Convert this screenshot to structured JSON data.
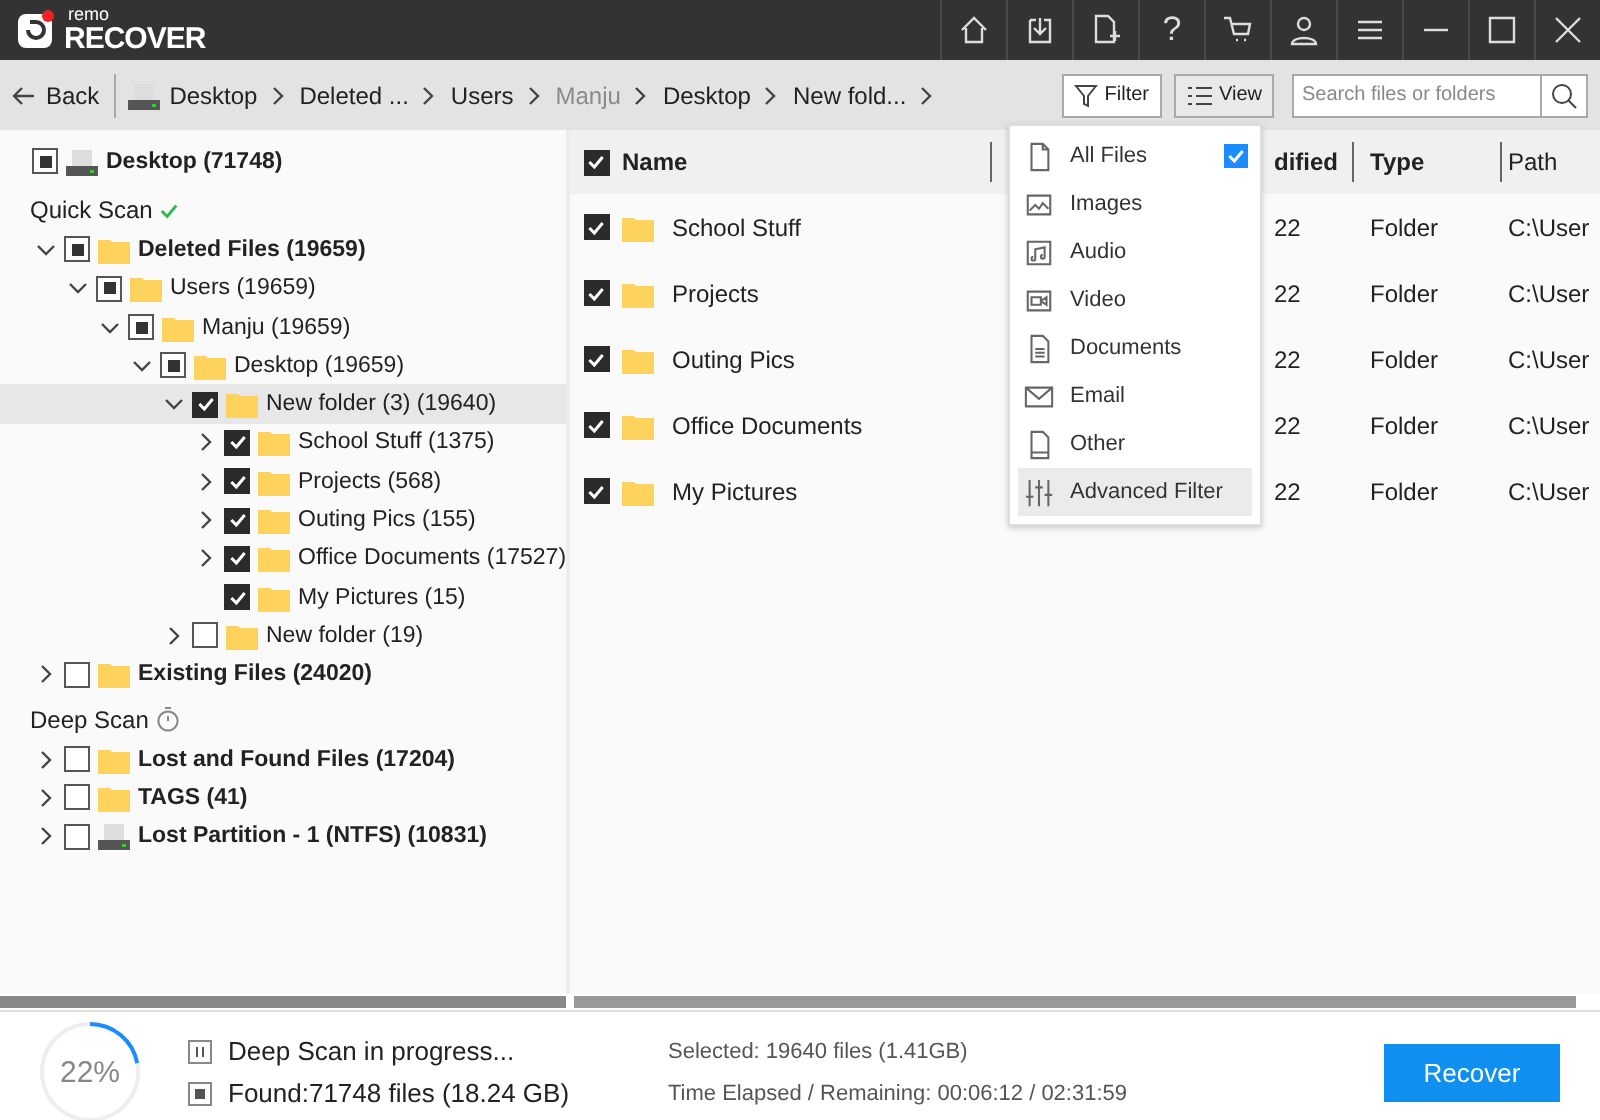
{
  "app": {
    "logo_small": "remo",
    "logo_large": "RECOVER",
    "help": "?"
  },
  "toolbar": {
    "back": "Back",
    "breadcrumb": [
      {
        "label": "Desktop",
        "kind": "drive"
      },
      {
        "label": "Deleted ...",
        "kind": "plain"
      },
      {
        "label": "Users",
        "kind": "plain"
      },
      {
        "label": "Manju",
        "kind": "masked"
      },
      {
        "label": "Desktop",
        "kind": "plain"
      },
      {
        "label": "New fold...",
        "kind": "plain"
      }
    ],
    "filter": "Filter",
    "view": "View",
    "search": {
      "placeholder": "Search files or folders"
    }
  },
  "tree": {
    "drive": {
      "label": "Desktop (71748)",
      "checked": false,
      "partial": true
    },
    "sections": [
      {
        "title": "Quick Scan",
        "kind": "done",
        "items": [
          {
            "label": "Deleted Files (19659)",
            "checked": false,
            "partial": true,
            "expandable": true,
            "expanded": true,
            "kind": "folder",
            "selected": false,
            "children": [
              {
                "label": "Users (19659)",
                "checked": false,
                "partial": true,
                "expandable": true,
                "expanded": true,
                "kind": "folder",
                "selected": false,
                "children": [
                  {
                    "label": "Manju (19659)",
                    "checked": false,
                    "partial": true,
                    "expandable": true,
                    "expanded": true,
                    "kind": "folder",
                    "selected": false,
                    "children": [
                      {
                        "label": "Desktop (19659)",
                        "checked": false,
                        "partial": true,
                        "expandable": true,
                        "expanded": true,
                        "kind": "folder",
                        "selected": false,
                        "children": [
                          {
                            "label": "New folder (3) (19640)",
                            "checked": true,
                            "expandable": true,
                            "expanded": true,
                            "kind": "folder",
                            "selected": true,
                            "children": [
                              {
                                "label": "School Stuff (1375)",
                                "checked": true,
                                "expandable": true,
                                "expanded": false,
                                "kind": "folder",
                                "selected": false
                              },
                              {
                                "label": "Projects (568)",
                                "checked": true,
                                "expandable": true,
                                "expanded": false,
                                "kind": "folder",
                                "selected": false
                              },
                              {
                                "label": "Outing Pics (155)",
                                "checked": true,
                                "expandable": true,
                                "expanded": false,
                                "kind": "folder",
                                "selected": false
                              },
                              {
                                "label": "Office Documents (17527)",
                                "checked": true,
                                "expandable": true,
                                "expanded": false,
                                "kind": "folder",
                                "selected": false
                              },
                              {
                                "label": "My Pictures (15)",
                                "checked": true,
                                "expandable": false,
                                "kind": "folder",
                                "selected": false
                              }
                            ]
                          },
                          {
                            "label": "New folder (19)",
                            "checked": false,
                            "partial": false,
                            "expandable": true,
                            "expanded": false,
                            "kind": "folder",
                            "selected": false
                          }
                        ]
                      }
                    ]
                  }
                ]
              }
            ]
          },
          {
            "label": "Existing Files (24020)",
            "checked": false,
            "partial": false,
            "expandable": true,
            "expanded": false,
            "kind": "folder",
            "selected": false
          }
        ]
      },
      {
        "title": "Deep Scan",
        "kind": "pending",
        "items": [
          {
            "label": "Lost and Found Files (17204)",
            "checked": false,
            "partial": false,
            "expandable": true,
            "expanded": false,
            "kind": "folder",
            "selected": false
          },
          {
            "label": "TAGS (41)",
            "checked": false,
            "partial": false,
            "expandable": true,
            "expanded": false,
            "kind": "folder",
            "selected": false
          },
          {
            "label": "Lost Partition - 1 (NTFS) (10831)",
            "checked": false,
            "partial": false,
            "expandable": true,
            "expanded": false,
            "kind": "partition",
            "selected": false
          }
        ]
      }
    ]
  },
  "table": {
    "all_checked": true,
    "columns": [
      "Name",
      "dified",
      "Type",
      "Path"
    ],
    "rows": [
      {
        "checked": true,
        "name": "School Stuff",
        "modified": "22",
        "type": "Folder",
        "path": "C:\\User"
      },
      {
        "checked": true,
        "name": "Projects",
        "modified": "22",
        "type": "Folder",
        "path": "C:\\User"
      },
      {
        "checked": true,
        "name": "Outing Pics",
        "modified": "22",
        "type": "Folder",
        "path": "C:\\User"
      },
      {
        "checked": true,
        "name": "Office Documents",
        "modified": "22",
        "type": "Folder",
        "path": "C:\\User"
      },
      {
        "checked": true,
        "name": "My Pictures",
        "modified": "22",
        "type": "Folder",
        "path": "C:\\User"
      }
    ]
  },
  "filter_menu": [
    {
      "label": "All Files",
      "kind": "all",
      "checked": true,
      "selected": false
    },
    {
      "label": "Images",
      "kind": "image",
      "checked": false,
      "selected": false
    },
    {
      "label": "Audio",
      "kind": "audio",
      "checked": false,
      "selected": false
    },
    {
      "label": "Video",
      "kind": "video",
      "checked": false,
      "selected": false
    },
    {
      "label": "Documents",
      "kind": "document",
      "checked": false,
      "selected": false
    },
    {
      "label": "Email",
      "kind": "email",
      "checked": false,
      "selected": false
    },
    {
      "label": "Other",
      "kind": "other",
      "checked": false,
      "selected": false
    },
    {
      "label": "Advanced Filter",
      "kind": "advanced",
      "checked": false,
      "selected": true
    }
  ],
  "status": {
    "progress": {
      "level": 0.22,
      "reading": "22%"
    },
    "scan_text": "Deep Scan in progress...",
    "found": "Found:71748 files (18.24 GB)",
    "selected": "Selected: 19640 files (1.41GB)",
    "time": "Time Elapsed / Remaining: 00:06:12 / 02:31:59",
    "recover": "Recover"
  }
}
